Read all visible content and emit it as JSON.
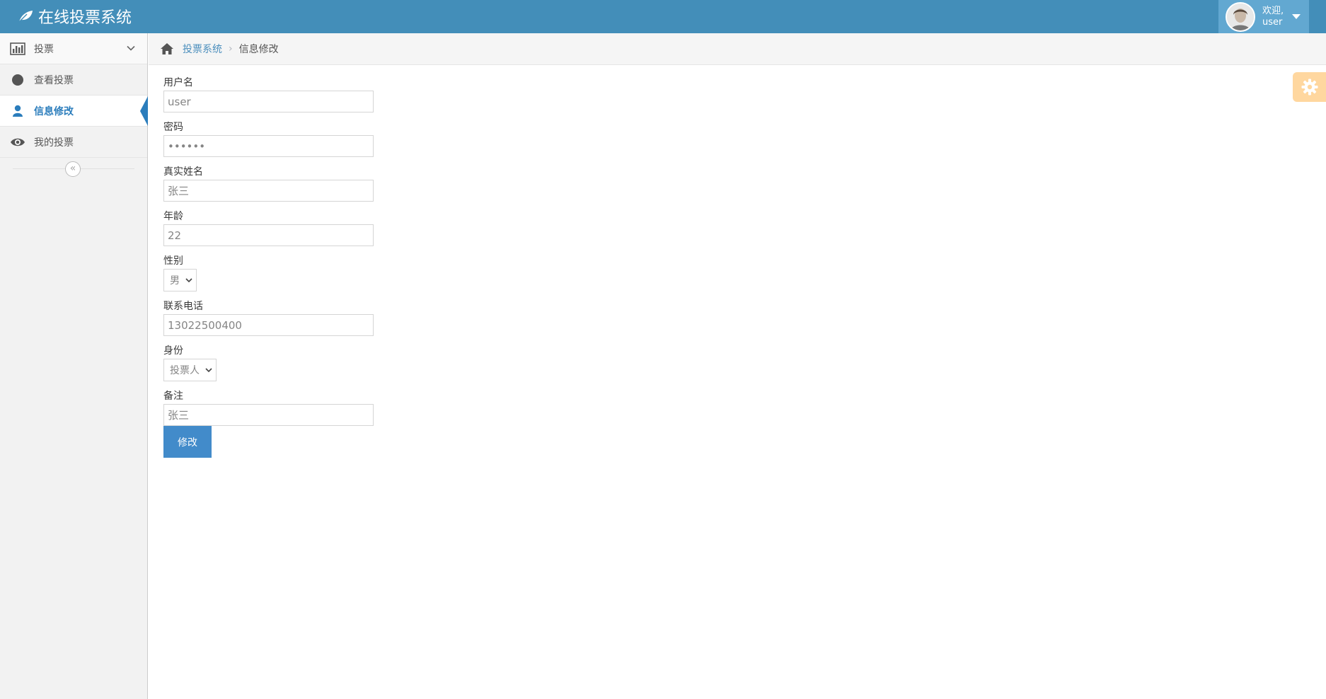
{
  "app": {
    "title": "在线投票系统"
  },
  "user": {
    "welcome": "欢迎,",
    "name": "user"
  },
  "sidebar": {
    "items": [
      {
        "label": "投票",
        "icon": "bar-chart-icon"
      },
      {
        "label": "查看投票",
        "icon": "circle-icon"
      },
      {
        "label": "信息修改",
        "icon": "user-icon",
        "active": true
      },
      {
        "label": "我的投票",
        "icon": "eye-icon"
      }
    ],
    "collapse_glyph": "«"
  },
  "breadcrumb": {
    "home": "投票系统",
    "separator": "›",
    "current": "信息修改"
  },
  "form": {
    "username": {
      "label": "用户名",
      "value": "user"
    },
    "password": {
      "label": "密码",
      "value": "••••••"
    },
    "realname": {
      "label": "真实姓名",
      "value": "张三"
    },
    "age": {
      "label": "年龄",
      "value": "22"
    },
    "gender": {
      "label": "性别",
      "value": "男"
    },
    "phone": {
      "label": "联系电话",
      "value": "13022500400"
    },
    "role": {
      "label": "身份",
      "value": "投票人"
    },
    "note": {
      "label": "备注",
      "value": "张三"
    },
    "submit_label": "修改"
  },
  "colors": {
    "navbar": "#438eb9",
    "user_menu": "#62a8d1",
    "accent": "#2b7dbc",
    "button": "#428bca",
    "settings": "#ffb752"
  }
}
